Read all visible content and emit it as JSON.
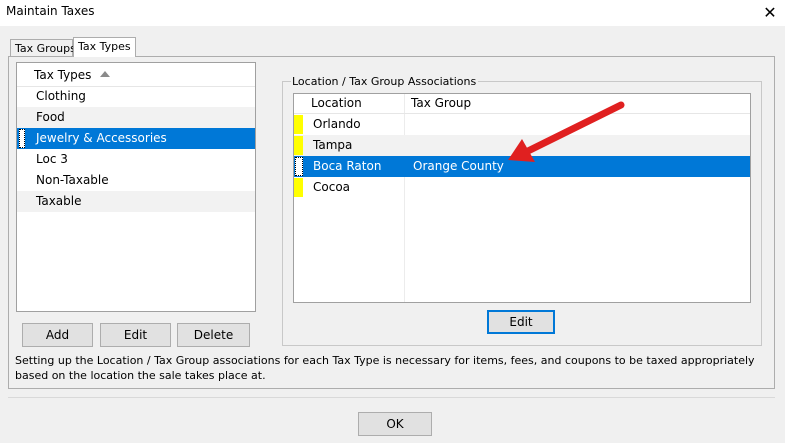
{
  "window": {
    "title": "Maintain Taxes",
    "close_symbol": "✕"
  },
  "tabs": [
    {
      "label": "Tax Groups",
      "active": false
    },
    {
      "label": "Tax Types",
      "active": true
    }
  ],
  "tax_types": {
    "header": "Tax Types",
    "items": [
      {
        "label": "Clothing",
        "selected": false
      },
      {
        "label": "Food",
        "selected": false
      },
      {
        "label": "Jewelry & Accessories",
        "selected": true
      },
      {
        "label": "Loc 3",
        "selected": false
      },
      {
        "label": "Non-Taxable",
        "selected": false
      },
      {
        "label": "Taxable",
        "selected": false
      }
    ],
    "buttons": {
      "add": "Add",
      "edit": "Edit",
      "delete": "Delete"
    }
  },
  "associations": {
    "group_label": "Location / Tax Group Associations",
    "columns": [
      "Location",
      "Tax Group"
    ],
    "rows": [
      {
        "location": "Orlando",
        "tax_group": "",
        "selected": false
      },
      {
        "location": "Tampa",
        "tax_group": "",
        "selected": false
      },
      {
        "location": "Boca Raton",
        "tax_group": "Orange County",
        "selected": true
      },
      {
        "location": "Cocoa",
        "tax_group": "",
        "selected": false
      }
    ],
    "edit_button": "Edit"
  },
  "note": "Setting up the Location / Tax Group associations for each Tax Type is necessary for items, fees, and coupons to be taxed appropriately based on the location the sale takes place at.",
  "footer": {
    "ok_label": "OK"
  },
  "colors": {
    "selection": "#0078d7",
    "row_marker": "#ffff00",
    "annotation_arrow": "#e02020"
  }
}
